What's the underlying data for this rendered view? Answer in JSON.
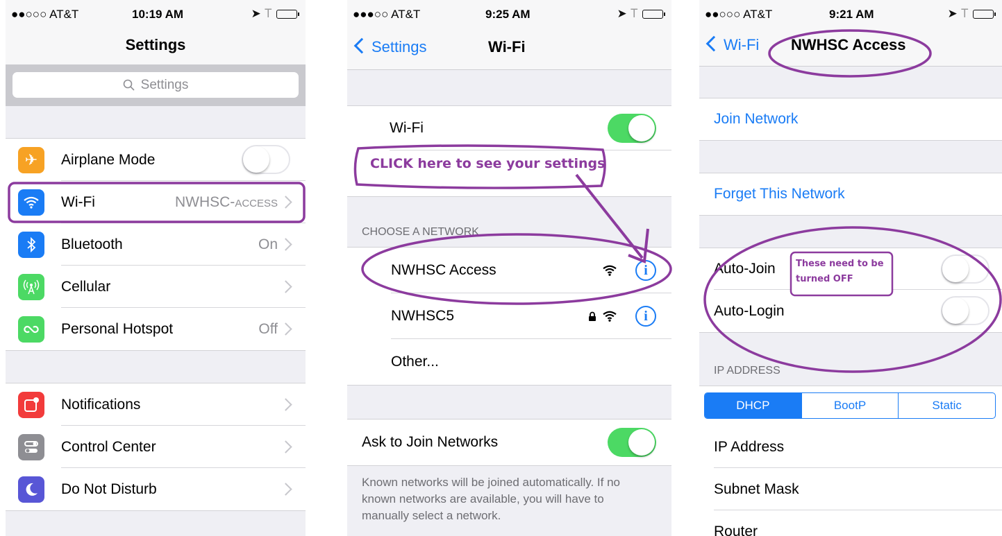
{
  "colors": {
    "accent": "#1a7cf5",
    "toggle_on": "#4cd964",
    "annotation": "#8c3b9e"
  },
  "panel1": {
    "status": {
      "signal": "●●○○○ AT&T",
      "time": "10:19 AM"
    },
    "title": "Settings",
    "search_placeholder": "Settings",
    "rows": [
      {
        "label": "Airplane Mode",
        "icon": "airplane-icon",
        "color": "#f7a224"
      },
      {
        "label": "Wi-Fi",
        "value": "NWHSC-",
        "value_small": "ACCESS",
        "icon": "wifi-icon",
        "color": "#1a7cf5"
      },
      {
        "label": "Bluetooth",
        "value": "On",
        "icon": "bluetooth-icon",
        "color": "#1a7cf5"
      },
      {
        "label": "Cellular",
        "value": "",
        "icon": "cellular-icon",
        "color": "#4cd964"
      },
      {
        "label": "Personal Hotspot",
        "value": "Off",
        "icon": "hotspot-icon",
        "color": "#4cd964"
      },
      {
        "label": "Notifications",
        "icon": "notifications-icon",
        "color": "#f23b3b"
      },
      {
        "label": "Control Center",
        "icon": "control-center-icon",
        "color": "#8e8e93"
      },
      {
        "label": "Do Not Disturb",
        "icon": "moon-icon",
        "color": "#5856d6"
      }
    ],
    "airplane_mode": false
  },
  "panel2": {
    "status": {
      "signal": "●●●○○ AT&T",
      "time": "9:25 AM"
    },
    "back": "Settings",
    "title": "Wi-Fi",
    "wifi_label": "Wi-Fi",
    "wifi_on": true,
    "annotation": "CLICK here to see your settings",
    "section": "CHOOSE A NETWORK",
    "networks": [
      {
        "name": "NWHSC Access",
        "locked": false
      },
      {
        "name": "NWHSC5",
        "locked": true
      },
      {
        "name": "Other..."
      }
    ],
    "ask_label": "Ask to Join Networks",
    "ask_on": true,
    "footer": "Known networks will be joined automatically. If no known networks are available, you will have to manually select a network."
  },
  "panel3": {
    "status": {
      "signal": "●●○○○ AT&T",
      "time": "9:21 AM"
    },
    "back": "Wi-Fi",
    "title": "NWHSC Access",
    "join": "Join Network",
    "forget": "Forget This Network",
    "auto_join": "Auto-Join",
    "auto_login": "Auto-Login",
    "auto_join_on": false,
    "auto_login_on": false,
    "annotation_line1": "These need to be",
    "annotation_line2": "turned OFF",
    "ip_header": "IP ADDRESS",
    "segments": [
      "DHCP",
      "BootP",
      "Static"
    ],
    "selected_segment": "DHCP",
    "fields": [
      "IP Address",
      "Subnet Mask",
      "Router"
    ]
  }
}
